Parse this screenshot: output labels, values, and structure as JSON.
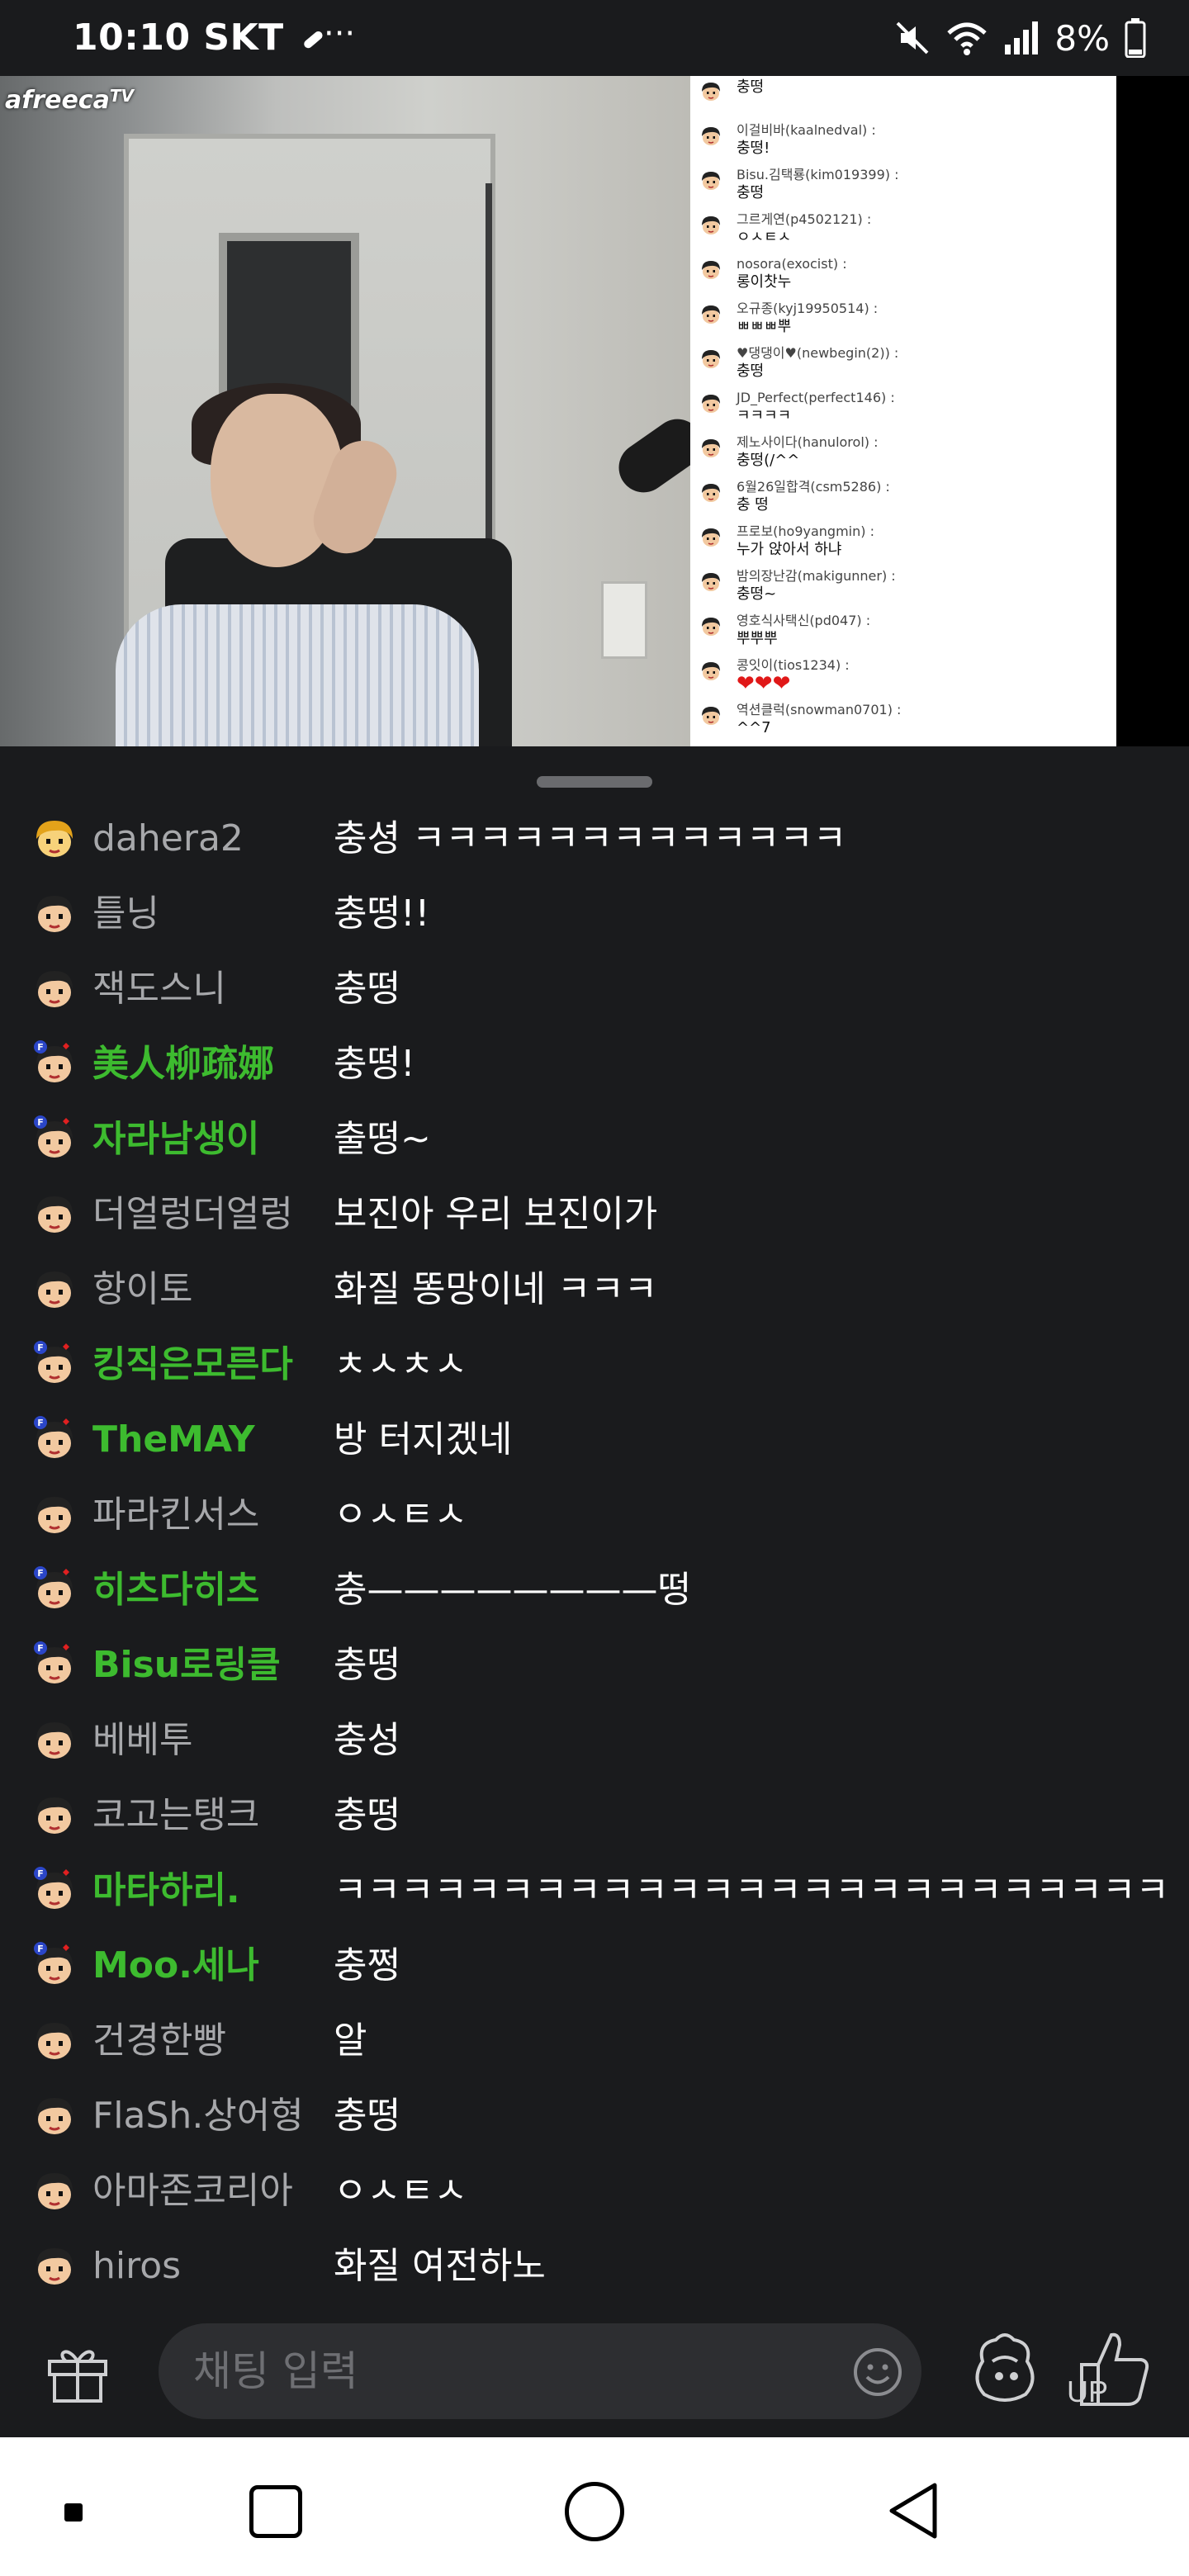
{
  "status_bar": {
    "time": "10:10",
    "carrier": "SKT",
    "more": "···",
    "battery_percent": "8%"
  },
  "video": {
    "logo_text": "afreeca",
    "logo_suffix": "TV",
    "overlay_chat": [
      {
        "name": "",
        "msg": "충떵"
      },
      {
        "name": "이걸비바(kaalnedval) :",
        "msg": "충떵!"
      },
      {
        "name": "Bisu.김택룡(kim019399) :",
        "msg": "충떵"
      },
      {
        "name": "그르게연(p4502121) :",
        "msg": "ㅇㅅㅌㅅ"
      },
      {
        "name": "nosora(exocist) :",
        "msg": "롱이찻누"
      },
      {
        "name": "오규종(kyj19950514) :",
        "msg": "ㅃㅃㅃ뿌"
      },
      {
        "name": "♥댕댕이♥(newbegin(2)) :",
        "msg": "충떵"
      },
      {
        "name": "JD_Perfect(perfect146) :",
        "msg": "ㅋㅋㅋㅋ"
      },
      {
        "name": "제노사이다(hanulorol) :",
        "msg": "충떵(/^^"
      },
      {
        "name": "6월26일합격(csm5286) :",
        "msg": "충 떵"
      },
      {
        "name": "프로보(ho9yangmin) :",
        "msg": "누가 앉아서 하냐"
      },
      {
        "name": "밤의장난감(makigunner) :",
        "msg": "충떵~"
      },
      {
        "name": "영호식사택신(pd047) :",
        "msg": "뿌뿌뿌"
      },
      {
        "name": "콩잇이(tios1234) :",
        "msg": "❤❤❤"
      },
      {
        "name": "역션클럭(snowman0701) :",
        "msg": "^^7"
      }
    ]
  },
  "chat": {
    "messages": [
      {
        "user": "dahera2",
        "text": "충셩 ㅋㅋㅋㅋㅋㅋㅋㅋㅋㅋㅋㅋㅋ",
        "fan": false,
        "avatar": "gold-face-icon"
      },
      {
        "user": "틀닝",
        "text": "충떵!!",
        "fan": false,
        "avatar": "user-face-icon"
      },
      {
        "user": "잭도스니",
        "text": "충떵",
        "fan": false,
        "avatar": "user-face-icon"
      },
      {
        "user": "美人柳疏娜",
        "text": "충떵!",
        "fan": true,
        "avatar": "fan-face-icon"
      },
      {
        "user": "자라남생이",
        "text": "출떵~",
        "fan": true,
        "avatar": "fan-face-icon"
      },
      {
        "user": "더얼렁더얼렁",
        "text": "보진아 우리 보진이가",
        "fan": false,
        "avatar": "user-face-icon"
      },
      {
        "user": "항이토",
        "text": "화질  똥망이네 ㅋㅋㅋ",
        "fan": false,
        "avatar": "user-face-icon"
      },
      {
        "user": "킹직은모른다",
        "text": "ㅊㅅㅊㅅ",
        "fan": true,
        "avatar": "fan-face-icon"
      },
      {
        "user": "TheMAY",
        "text": "방 터지겠네",
        "fan": true,
        "avatar": "fan-face-icon"
      },
      {
        "user": "파라킨서스",
        "text": "ㅇㅅㅌㅅ",
        "fan": false,
        "avatar": "user-face-icon"
      },
      {
        "user": "히츠다히츠",
        "text": "충————————떵",
        "fan": true,
        "avatar": "fan-face-icon"
      },
      {
        "user": "Bisu로링클",
        "text": "충떵",
        "fan": true,
        "avatar": "fan-face-icon"
      },
      {
        "user": "베베투",
        "text": "충성",
        "fan": false,
        "avatar": "user-face-icon"
      },
      {
        "user": "코고는탱크",
        "text": "충떵",
        "fan": false,
        "avatar": "user-face-icon"
      },
      {
        "user": "마타하리.",
        "text": "ㅋㅋㅋㅋㅋㅋㅋㅋㅋㅋㅋㅋㅋㅋㅋㅋㅋㅋㅋㅋㅋㅋㅋㅋㅋ",
        "fan": true,
        "avatar": "fan-face-icon"
      },
      {
        "user": "Moo.세나",
        "text": "충쩡",
        "fan": true,
        "avatar": "fan-face-icon"
      },
      {
        "user": "건경한빵",
        "text": "알",
        "fan": false,
        "avatar": "user-face-icon"
      },
      {
        "user": "FlaSh.상어형",
        "text": "충떵",
        "fan": false,
        "avatar": "user-face-icon"
      },
      {
        "user": "아마존코리아",
        "text": "ㅇㅅㅌㅅ",
        "fan": false,
        "avatar": "user-face-icon"
      },
      {
        "user": "hiros",
        "text": "화질 여전하노",
        "fan": false,
        "avatar": "user-face-icon"
      }
    ]
  },
  "input_bar": {
    "placeholder": "채팅 입력",
    "up_label": "UP"
  },
  "colors": {
    "background": "#1a1b1d",
    "fan_name": "#3dbb2f",
    "normal_name": "#a7a8ab",
    "input_bg": "#2d2e31"
  }
}
